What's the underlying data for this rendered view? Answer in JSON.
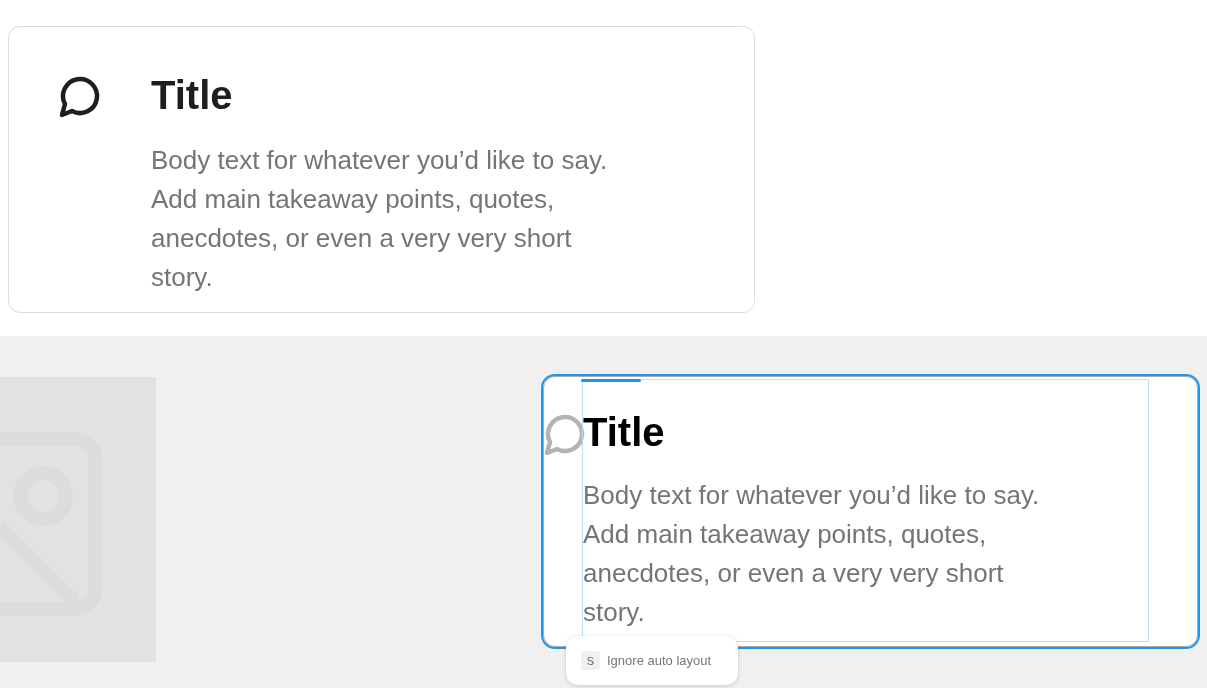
{
  "cards": [
    {
      "title": "Title",
      "body": "Body text for whatever you’d like to say. Add main takeaway points, quotes, anecdotes, or even a very very short story.",
      "selected": false
    },
    {
      "title": "Title",
      "body": "Body text for whatever you’d like to say. Add main takeaway points, quotes, anecdotes, or even a very very short story.",
      "selected": true
    }
  ],
  "tooltip": {
    "key": "S",
    "label": "Ignore auto layout"
  }
}
